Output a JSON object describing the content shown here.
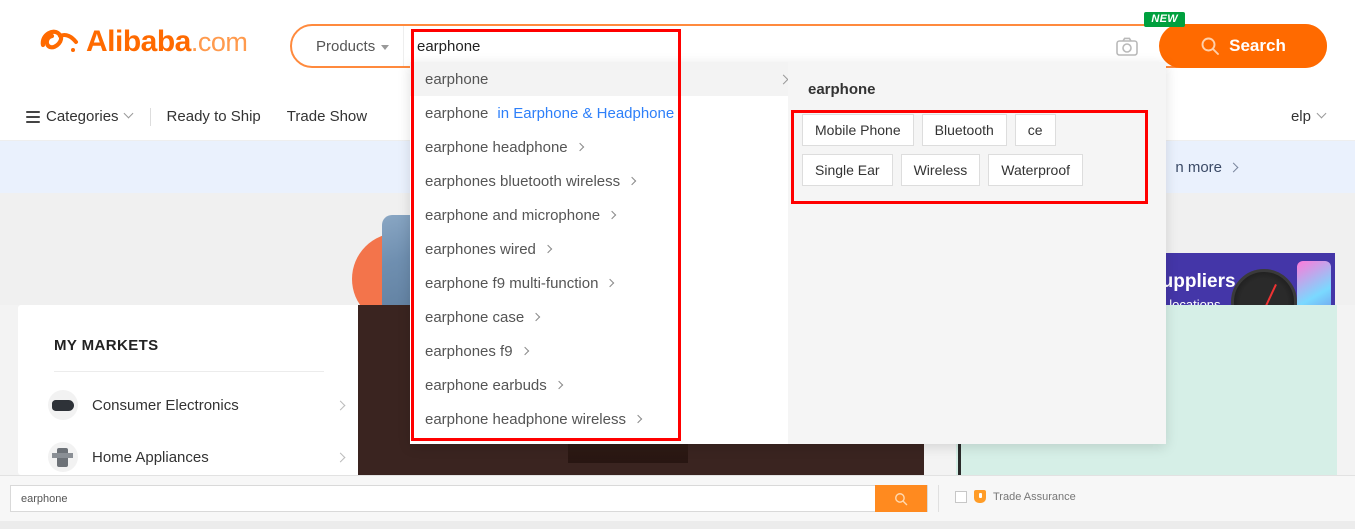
{
  "header": {
    "logo": {
      "brand": "Alibaba",
      "tld": ".com",
      "mark": "alibaba-swirl-icon"
    },
    "category_select": {
      "label": "Products",
      "icon": "chevron-down-icon"
    },
    "search": {
      "value": "earphone",
      "placeholder": "earphone",
      "camera_icon": "camera-icon",
      "button_label": "Search",
      "button_icon": "search-icon",
      "button_color": "#ff6a00",
      "new_badge": "NEW",
      "new_badge_color": "#00a03e"
    }
  },
  "nav": {
    "categories_label": "Categories",
    "items": [
      {
        "label": "Ready to Ship"
      },
      {
        "label": "Trade Show"
      }
    ],
    "help_label": "elp",
    "help_icon": "chevron-down-icon"
  },
  "page": {
    "promo_text": "n more",
    "promo_icon": "chevron-right-icon",
    "purple_ad": {
      "line1": "Suppliers",
      "line2": "ew locations",
      "button_icon": "arrow-right-icon",
      "gauge_value": "50",
      "background": "#4436a8"
    },
    "market_card": {
      "title": "MY MARKETS",
      "items": [
        {
          "label": "Consumer Electronics",
          "icon": "vr-headset-icon",
          "arrow": "chevron-right-icon"
        },
        {
          "label": "Home Appliances",
          "icon": "appliance-icon",
          "arrow": "chevron-right-icon"
        }
      ]
    }
  },
  "dropdown": {
    "first_suggestion": {
      "text": "earphone",
      "arrow": "chevron-right-icon"
    },
    "suggestions": [
      {
        "text": "earphone",
        "highlight": " in Earphone & Headphone",
        "arrow": false
      },
      {
        "text": "earphone headphone",
        "highlight": "",
        "arrow": true
      },
      {
        "text": "earphones bluetooth wireless",
        "highlight": "",
        "arrow": true
      },
      {
        "text": "earphone and microphone",
        "highlight": "",
        "arrow": true
      },
      {
        "text": "earphones wired",
        "highlight": "",
        "arrow": true
      },
      {
        "text": "earphone f9 multi-function",
        "highlight": "",
        "arrow": true
      },
      {
        "text": "earphone case",
        "highlight": "",
        "arrow": true
      },
      {
        "text": "earphones f9",
        "highlight": "",
        "arrow": true
      },
      {
        "text": "earphone earbuds",
        "highlight": "",
        "arrow": true
      },
      {
        "text": "earphone headphone wireless",
        "highlight": "",
        "arrow": true
      }
    ],
    "right_panel": {
      "title": "earphone",
      "chips": [
        "Mobile Phone",
        "Bluetooth",
        "ce",
        "Single Ear",
        "Wireless",
        "Waterproof"
      ]
    }
  },
  "annotations": {
    "box_color": "#ff0000",
    "boxes": [
      {
        "name": "search-input-and-suggestions"
      },
      {
        "name": "related-keyword-chips"
      }
    ]
  },
  "bottom_bar": {
    "search_value": "earphone",
    "search_placeholder": "earphone",
    "go_icon": "search-icon",
    "trade_assurance_label": "Trade Assurance",
    "trade_assurance_icon": "shield-icon"
  }
}
